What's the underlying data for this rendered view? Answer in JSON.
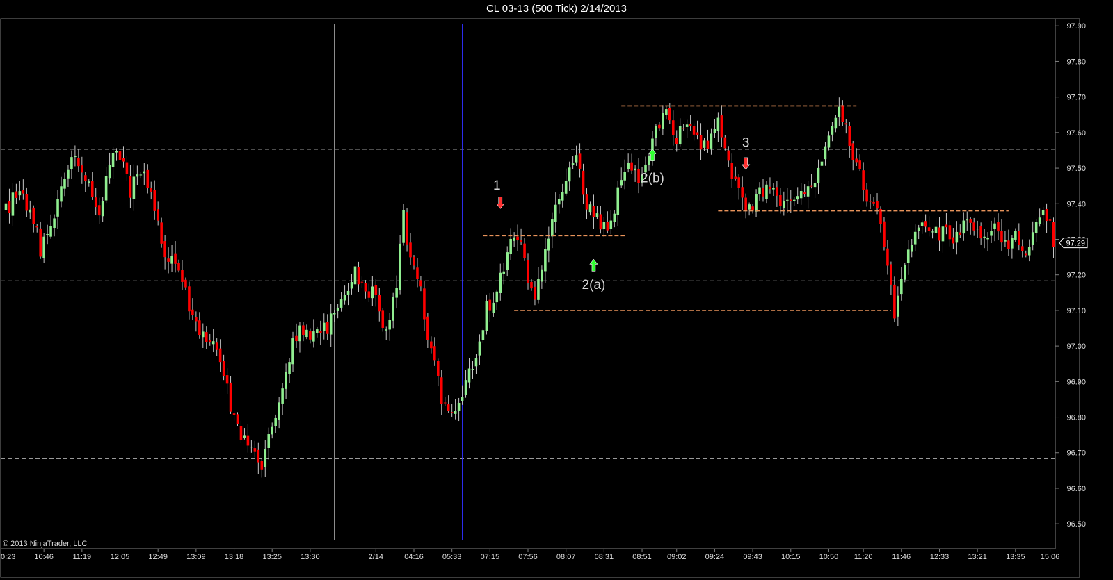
{
  "chart_data": {
    "type": "candlestick",
    "title": "CL 03-13 (500 Tick)  2/14/2013",
    "copyright": "© 2013 NinjaTrader, LLC",
    "ylim": [
      96.43,
      97.92
    ],
    "y_ticks": [
      "96.50",
      "96.60",
      "96.70",
      "96.80",
      "96.90",
      "97.00",
      "97.10",
      "97.20",
      "97.30",
      "97.40",
      "97.50",
      "97.60",
      "97.70",
      "97.80",
      "97.90"
    ],
    "x_tick_labels": [
      {
        "label": "0:23",
        "bar": 0
      },
      {
        "label": "10:46",
        "bar": 11
      },
      {
        "label": "11:19",
        "bar": 22
      },
      {
        "label": "12:05",
        "bar": 33
      },
      {
        "label": "12:49",
        "bar": 44
      },
      {
        "label": "13:09",
        "bar": 55
      },
      {
        "label": "13:18",
        "bar": 66
      },
      {
        "label": "13:25",
        "bar": 77
      },
      {
        "label": "13:30",
        "bar": 88
      },
      {
        "label": "2/14",
        "bar": 107
      },
      {
        "label": "04:16",
        "bar": 118
      },
      {
        "label": "05:33",
        "bar": 129
      },
      {
        "label": "07:15",
        "bar": 140
      },
      {
        "label": "07:56",
        "bar": 151
      },
      {
        "label": "08:07",
        "bar": 162
      },
      {
        "label": "08:31",
        "bar": 173
      },
      {
        "label": "08:51",
        "bar": 184
      },
      {
        "label": "09:02",
        "bar": 194
      },
      {
        "label": "09:24",
        "bar": 205
      },
      {
        "label": "09:43",
        "bar": 216
      },
      {
        "label": "10:15",
        "bar": 227
      },
      {
        "label": "10:50",
        "bar": 238
      },
      {
        "label": "11:20",
        "bar": 248
      },
      {
        "label": "11:46",
        "bar": 259
      },
      {
        "label": "12:33",
        "bar": 270
      },
      {
        "label": "13:21",
        "bar": 281
      },
      {
        "label": "13:35",
        "bar": 292
      },
      {
        "label": "15:06",
        "bar": 302
      }
    ],
    "anchors": [
      {
        "bar": 0,
        "price": 97.38
      },
      {
        "bar": 4,
        "price": 97.45
      },
      {
        "bar": 8,
        "price": 97.35
      },
      {
        "bar": 10,
        "price": 97.27
      },
      {
        "bar": 13,
        "price": 97.32
      },
      {
        "bar": 17,
        "price": 97.48
      },
      {
        "bar": 20,
        "price": 97.55
      },
      {
        "bar": 24,
        "price": 97.45
      },
      {
        "bar": 27,
        "price": 97.38
      },
      {
        "bar": 30,
        "price": 97.52
      },
      {
        "bar": 32,
        "price": 97.55
      },
      {
        "bar": 36,
        "price": 97.44
      },
      {
        "bar": 40,
        "price": 97.5
      },
      {
        "bar": 43,
        "price": 97.4
      },
      {
        "bar": 46,
        "price": 97.25
      },
      {
        "bar": 50,
        "price": 97.23
      },
      {
        "bar": 53,
        "price": 97.12
      },
      {
        "bar": 56,
        "price": 97.02
      },
      {
        "bar": 60,
        "price": 97.03
      },
      {
        "bar": 63,
        "price": 96.92
      },
      {
        "bar": 66,
        "price": 96.8
      },
      {
        "bar": 70,
        "price": 96.72
      },
      {
        "bar": 74,
        "price": 96.67
      },
      {
        "bar": 76,
        "price": 96.75
      },
      {
        "bar": 79,
        "price": 96.85
      },
      {
        "bar": 82,
        "price": 96.97
      },
      {
        "bar": 85,
        "price": 97.06
      },
      {
        "bar": 89,
        "price": 97.03
      },
      {
        "bar": 93,
        "price": 97.05
      },
      {
        "bar": 97,
        "price": 97.13
      },
      {
        "bar": 101,
        "price": 97.2
      },
      {
        "bar": 104,
        "price": 97.17
      },
      {
        "bar": 107,
        "price": 97.13
      },
      {
        "bar": 110,
        "price": 97.03
      },
      {
        "bar": 113,
        "price": 97.18
      },
      {
        "bar": 115,
        "price": 97.37
      },
      {
        "bar": 117,
        "price": 97.25
      },
      {
        "bar": 120,
        "price": 97.15
      },
      {
        "bar": 123,
        "price": 96.98
      },
      {
        "bar": 126,
        "price": 96.86
      },
      {
        "bar": 129,
        "price": 96.82
      },
      {
        "bar": 132,
        "price": 96.86
      },
      {
        "bar": 136,
        "price": 96.97
      },
      {
        "bar": 139,
        "price": 97.11
      },
      {
        "bar": 142,
        "price": 97.14
      },
      {
        "bar": 145,
        "price": 97.28
      },
      {
        "bar": 148,
        "price": 97.31
      },
      {
        "bar": 151,
        "price": 97.2
      },
      {
        "bar": 153,
        "price": 97.11
      },
      {
        "bar": 156,
        "price": 97.28
      },
      {
        "bar": 159,
        "price": 97.38
      },
      {
        "bar": 162,
        "price": 97.46
      },
      {
        "bar": 165,
        "price": 97.52
      },
      {
        "bar": 168,
        "price": 97.4
      },
      {
        "bar": 171,
        "price": 97.37
      },
      {
        "bar": 174,
        "price": 97.31
      },
      {
        "bar": 177,
        "price": 97.44
      },
      {
        "bar": 180,
        "price": 97.5
      },
      {
        "bar": 183,
        "price": 97.48
      },
      {
        "bar": 186,
        "price": 97.53
      },
      {
        "bar": 189,
        "price": 97.63
      },
      {
        "bar": 191,
        "price": 97.66
      },
      {
        "bar": 194,
        "price": 97.59
      },
      {
        "bar": 197,
        "price": 97.62
      },
      {
        "bar": 200,
        "price": 97.58
      },
      {
        "bar": 203,
        "price": 97.56
      },
      {
        "bar": 206,
        "price": 97.63
      },
      {
        "bar": 209,
        "price": 97.5
      },
      {
        "bar": 212,
        "price": 97.43
      },
      {
        "bar": 215,
        "price": 97.39
      },
      {
        "bar": 218,
        "price": 97.43
      },
      {
        "bar": 221,
        "price": 97.45
      },
      {
        "bar": 224,
        "price": 97.38
      },
      {
        "bar": 227,
        "price": 97.41
      },
      {
        "bar": 230,
        "price": 97.42
      },
      {
        "bar": 233,
        "price": 97.46
      },
      {
        "bar": 236,
        "price": 97.5
      },
      {
        "bar": 239,
        "price": 97.63
      },
      {
        "bar": 241,
        "price": 97.68
      },
      {
        "bar": 243,
        "price": 97.6
      },
      {
        "bar": 246,
        "price": 97.52
      },
      {
        "bar": 249,
        "price": 97.4
      },
      {
        "bar": 252,
        "price": 97.37
      },
      {
        "bar": 255,
        "price": 97.22
      },
      {
        "bar": 257,
        "price": 97.1
      },
      {
        "bar": 259,
        "price": 97.18
      },
      {
        "bar": 262,
        "price": 97.28
      },
      {
        "bar": 265,
        "price": 97.37
      },
      {
        "bar": 268,
        "price": 97.3
      },
      {
        "bar": 271,
        "price": 97.33
      },
      {
        "bar": 274,
        "price": 97.27
      },
      {
        "bar": 277,
        "price": 97.37
      },
      {
        "bar": 280,
        "price": 97.32
      },
      {
        "bar": 283,
        "price": 97.3
      },
      {
        "bar": 286,
        "price": 97.35
      },
      {
        "bar": 289,
        "price": 97.28
      },
      {
        "bar": 292,
        "price": 97.32
      },
      {
        "bar": 295,
        "price": 97.26
      },
      {
        "bar": 298,
        "price": 97.36
      },
      {
        "bar": 300,
        "price": 97.4
      },
      {
        "bar": 302,
        "price": 97.34
      },
      {
        "bar": 303,
        "price": 97.29
      }
    ],
    "bar_count": 304,
    "last_price": "97.29",
    "reference_levels": [
      97.553,
      97.183,
      96.683
    ],
    "session_lines": [
      {
        "bar": 95,
        "color": "#aaaaaa"
      },
      {
        "bar": 132,
        "color": "#3030ff"
      }
    ],
    "support_resistance_levels": [
      {
        "price": 97.675,
        "from_bar": 178,
        "to_bar": 246
      },
      {
        "price": 97.31,
        "from_bar": 138,
        "to_bar": 179
      },
      {
        "price": 97.38,
        "from_bar": 206,
        "to_bar": 290
      },
      {
        "price": 97.1,
        "from_bar": 147,
        "to_bar": 256
      }
    ],
    "annotations": [
      {
        "label": "1",
        "bar": 142,
        "price": 97.44,
        "arrow": "down",
        "arrow_price": 97.4,
        "color": "#ff3030"
      },
      {
        "label": "2(a)",
        "bar": 170,
        "price": 97.16,
        "arrow": "up",
        "arrow_price": 97.23,
        "color": "#30ff30"
      },
      {
        "label": "2(b)",
        "bar": 187,
        "price": 97.46,
        "arrow": "up",
        "arrow_price": 97.54,
        "color": "#30ff30"
      },
      {
        "label": "3",
        "bar": 214,
        "price": 97.56,
        "arrow": "down",
        "arrow_price": 97.51,
        "color": "#ff3030"
      }
    ],
    "colors": {
      "background": "#000000",
      "up_candle": "#90ee90",
      "down_candle": "#ff0000",
      "wick": "#c8c8c8",
      "reference_line": "#9a9a9a",
      "level_line": "#e8935a",
      "axis": "#808080"
    }
  }
}
